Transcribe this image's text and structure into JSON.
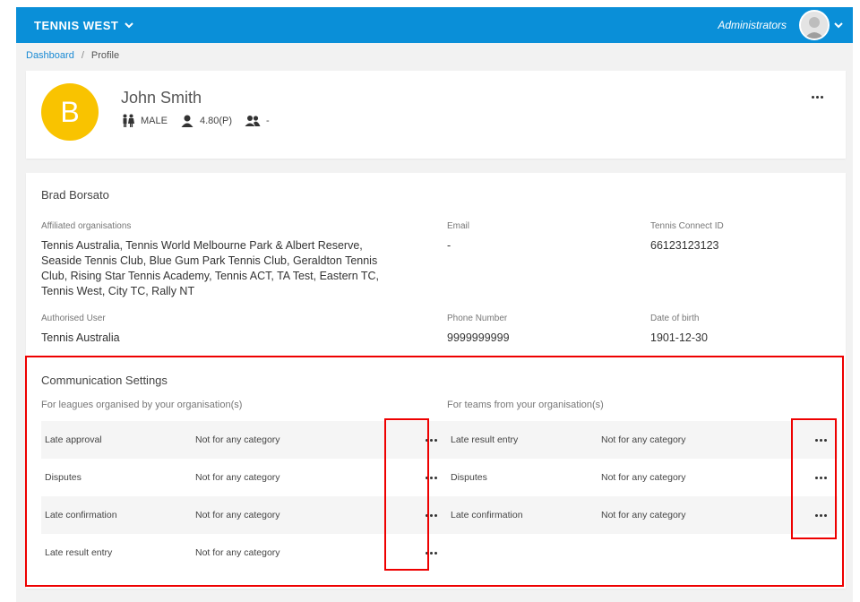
{
  "topbar": {
    "brand": "TENNIS WEST",
    "role": "Administrators"
  },
  "breadcrumb": {
    "link": "Dashboard",
    "separator": "/",
    "current": "Profile"
  },
  "profile": {
    "initial": "B",
    "name": "John Smith",
    "gender": "MALE",
    "rating": "4.80(P)",
    "teams": "-"
  },
  "details": {
    "name": "Brad Borsato",
    "affiliated_label": "Affiliated organisations",
    "affiliated_lines": [
      "Tennis Australia, Tennis World Melbourne Park & Albert Reserve,",
      "Seaside Tennis Club, Blue Gum Park Tennis Club, Geraldton Tennis",
      "Club, Rising Star Tennis Academy, Tennis ACT, TA Test, Eastern TC,",
      "Tennis West, City TC, Rally NT"
    ],
    "email_label": "Email",
    "email_value": "-",
    "connect_label": "Tennis Connect ID",
    "connect_value": "66123123123",
    "authorised_label": "Authorised User",
    "authorised_value": "Tennis Australia",
    "phone_label": "Phone Number",
    "phone_value": "9999999999",
    "dob_label": "Date of birth",
    "dob_value": "1901-12-30"
  },
  "communication": {
    "title": "Communication Settings",
    "leagues_heading": "For leagues organised by your organisation(s)",
    "teams_heading": "For teams from your organisation(s)",
    "leagues": [
      {
        "name": "Late approval",
        "value": "Not for any category"
      },
      {
        "name": "Disputes",
        "value": "Not for any category"
      },
      {
        "name": "Late confirmation",
        "value": "Not for any category"
      },
      {
        "name": "Late result entry",
        "value": "Not for any category"
      }
    ],
    "teams": [
      {
        "name": "Late result entry",
        "value": "Not for any category"
      },
      {
        "name": "Disputes",
        "value": "Not for any category"
      },
      {
        "name": "Late confirmation",
        "value": "Not for any category"
      }
    ]
  },
  "colors": {
    "topbar": "#0a8fd8",
    "avatar_initial_bg": "#f9c300",
    "link": "#1a8ad4",
    "highlight": "#e00000"
  },
  "icons": {
    "brand_dropdown": "chevron-down-icon",
    "user_dropdown": "chevron-down-icon",
    "gender": "male-female-icon",
    "rating": "person-icon",
    "teams": "group-icon",
    "more": "more-horizontal-icon"
  }
}
